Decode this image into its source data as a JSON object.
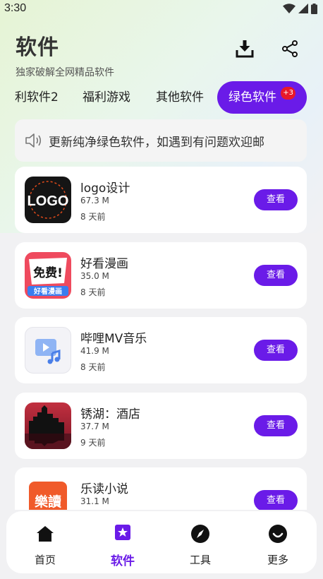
{
  "status": {
    "time": "3:30"
  },
  "header": {
    "title": "软件",
    "subtitle": "独家破解全网精品软件"
  },
  "tabs": [
    {
      "label": "利软件2"
    },
    {
      "label": "福利游戏"
    },
    {
      "label": "其他软件"
    },
    {
      "label": "绿色软件",
      "badge": "+3",
      "active": true
    }
  ],
  "notice": {
    "text": "更新纯净绿色软件，如遇到有问题欢迎邮"
  },
  "apps": [
    {
      "name": "logo设计",
      "size": "67.3 M",
      "time": "8 天前",
      "button": "查看",
      "icon_text": "LOGO"
    },
    {
      "name": "好看漫画",
      "size": "35.0 M",
      "time": "8 天前",
      "button": "查看",
      "icon_text": "免费!",
      "icon_subtext": "好看漫画"
    },
    {
      "name": "哔哩MV音乐",
      "size": "41.9 M",
      "time": "8 天前",
      "button": "查看"
    },
    {
      "name": "锈湖：酒店",
      "size": "37.7 M",
      "time": "9 天前",
      "button": "查看"
    },
    {
      "name": "乐读小说",
      "size": "31.1 M",
      "time": "",
      "button": "查看",
      "icon_text": "樂讀"
    }
  ],
  "nav": [
    {
      "label": "首页",
      "icon": "home-icon"
    },
    {
      "label": "软件",
      "icon": "software-icon",
      "active": true
    },
    {
      "label": "工具",
      "icon": "compass-icon"
    },
    {
      "label": "更多",
      "icon": "more-icon"
    }
  ],
  "colors": {
    "accent": "#6a1be8",
    "badge": "#e8182a",
    "background": "#f1f1f3"
  }
}
